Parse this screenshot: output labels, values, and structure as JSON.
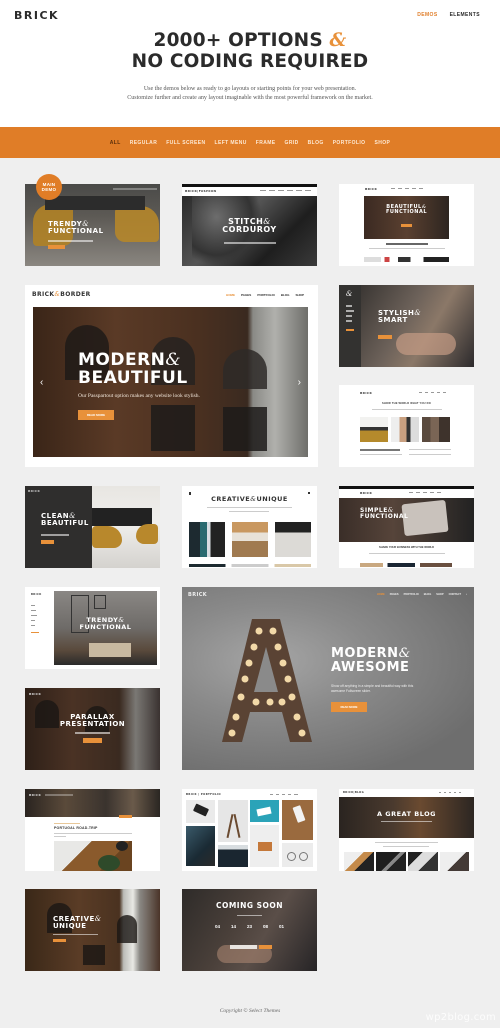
{
  "header": {
    "logo": "BRICK",
    "nav": [
      {
        "label": "DEMOS",
        "active": true
      },
      {
        "label": "ELEMENTS",
        "active": false
      }
    ]
  },
  "hero": {
    "title_line1": "2000+ OPTIONS",
    "title_amp": "&",
    "title_line2": "NO CODING REQUIRED",
    "subtitle_line1": "Use the demos below as ready to go layouts or starting points for your web presentation.",
    "subtitle_line2": "Customize further and create any layout imaginable with the most powerful framework on the market."
  },
  "filters": [
    {
      "label": "ALL",
      "active": true
    },
    {
      "label": "REGULAR"
    },
    {
      "label": "FULL SCREEN"
    },
    {
      "label": "LEFT MENU"
    },
    {
      "label": "FRAME"
    },
    {
      "label": "GRID"
    },
    {
      "label": "BLOG"
    },
    {
      "label": "PORTFOLIO"
    },
    {
      "label": "SHOP"
    }
  ],
  "badge": {
    "line1": "MAIN",
    "line2": "DEMO"
  },
  "demos": {
    "trendy_functional": {
      "title1": "TRENDY",
      "title2": "FUNCTIONAL"
    },
    "stitch_corduroy": {
      "title1": "STITCH",
      "title2": "CORDUROY"
    },
    "beautiful_functional": {
      "title1": "BEAUTIFUL",
      "title2": "FUNCTIONAL"
    },
    "brick_border": {
      "logo1": "BRICK",
      "logo2": "BORDER",
      "nav": [
        "HOME",
        "PAGES",
        "PORTFOLIO",
        "BLOG",
        "SHOP"
      ],
      "title1": "MODERN",
      "title2": "BEAUTIFUL",
      "subtitle": "Our Passpartout option makes any website look stylish.",
      "button": "READ MORE",
      "prev": "‹",
      "next": "›"
    },
    "stylish_smart": {
      "title1": "STYLISH",
      "title2": "SMART"
    },
    "share_world": {
      "logo": "BRICK",
      "heading": "SHOW THE WORLD WHAT YOU DO"
    },
    "clean_beautiful": {
      "logo": "BRICK",
      "title1": "CLEAN",
      "title2": "BEAUTIFUL"
    },
    "creative_unique_grid": {
      "title1": "CREATIVE",
      "title2": "UNIQUE"
    },
    "simple_functional": {
      "logo": "BRICK",
      "title1": "SIMPLE",
      "title2": "FUNCTIONAL",
      "heading": "SHARE YOUR BUSINESS WITH THE WORLD"
    },
    "trendy_functional_left": {
      "logo": "BRICK",
      "title1": "TRENDY",
      "title2": "FUNCTIONAL"
    },
    "modern_awesome": {
      "logo": "BRICK",
      "nav": [
        "HOME",
        "PAGES",
        "PORTFOLIO",
        "BLOG",
        "SHOP",
        "CONTACT"
      ],
      "title1": "MODERN",
      "title2": "AWESOME",
      "subtitle": "Show off anything in a simple and beautiful way with this awesome Fullscreen slider.",
      "button": "READ MORE"
    },
    "parallax": {
      "logo": "BRICK",
      "title1": "PARALLAX",
      "title2": "PRESENTATION"
    },
    "portugal_blog": {
      "logo": "BRICK",
      "post_title": "PORTUGAL ROAD-TRIP"
    },
    "portfolio_grid": {
      "logo": "BRICK | PORTFOLIO"
    },
    "great_blog": {
      "title": "A GREAT BLOG"
    },
    "creative_unique_parallax": {
      "title1": "CREATIVE",
      "title2": "UNIQUE"
    },
    "coming_soon": {
      "title": "COMING SOON",
      "countdown": [
        "04",
        "14",
        "23",
        "08",
        "01"
      ]
    }
  },
  "footer": {
    "copyright": "Copyright © Select Themes"
  },
  "watermark": "wp2blog.com",
  "colors": {
    "accent": "#e07d27",
    "accent_light": "#e8913a",
    "text": "#2b2b2b",
    "background": "#efefef"
  }
}
